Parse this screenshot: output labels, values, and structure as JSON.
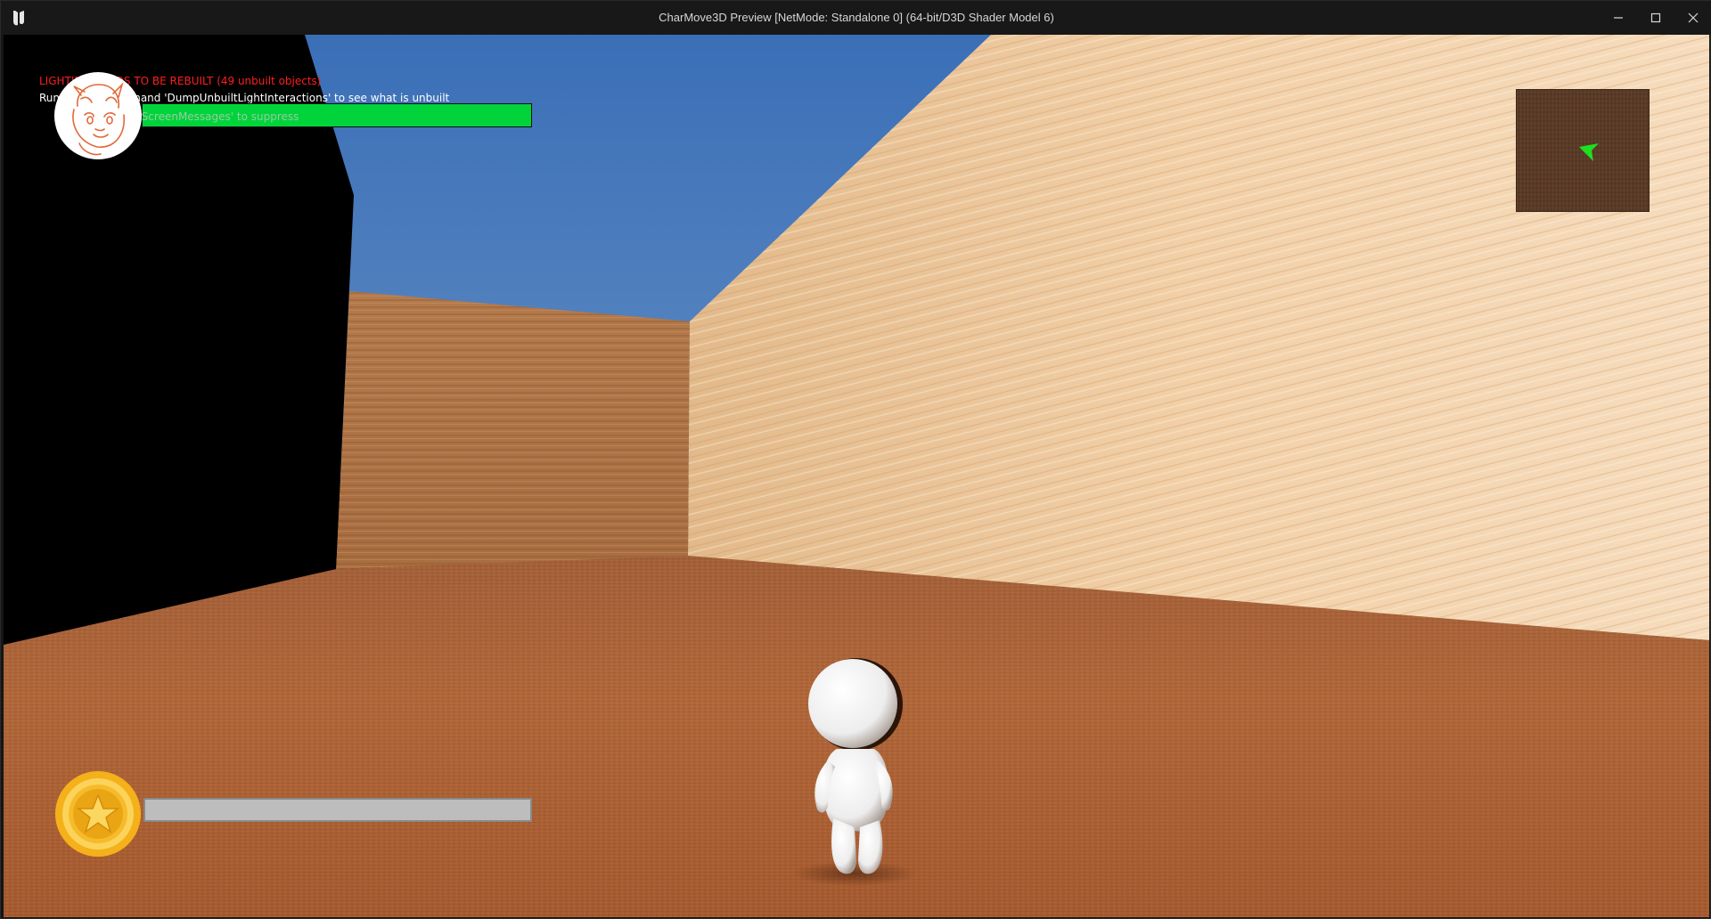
{
  "window": {
    "title": "CharMove3D Preview [NetMode: Standalone 0]  (64-bit/D3D Shader Model 6)",
    "logo_icon": "unreal-engine-logo-icon",
    "controls": [
      "minimize-icon",
      "maximize-icon",
      "close-icon"
    ]
  },
  "screen_messages": {
    "lighting_warning": "LIGHTING NEEDS TO BE REBUILT (49 unbuilt objects)",
    "console_hint": "Run console command 'DumpUnbuiltLightInteractions' to see what is unbuilt",
    "suppress_hint": "'DisableAllScreenMessages' to suppress",
    "warning_color": "#ff1e1e"
  },
  "hud": {
    "health": {
      "percent": 100,
      "color": "#00d43a",
      "icon": "character-portrait-icon"
    },
    "coins": {
      "percent": 0,
      "icon": "star-coin-icon",
      "bar_color": "#bdbdbd"
    },
    "minimap": {
      "icon": "player-arrow-icon",
      "arrow_color": "#1ee01e"
    }
  }
}
